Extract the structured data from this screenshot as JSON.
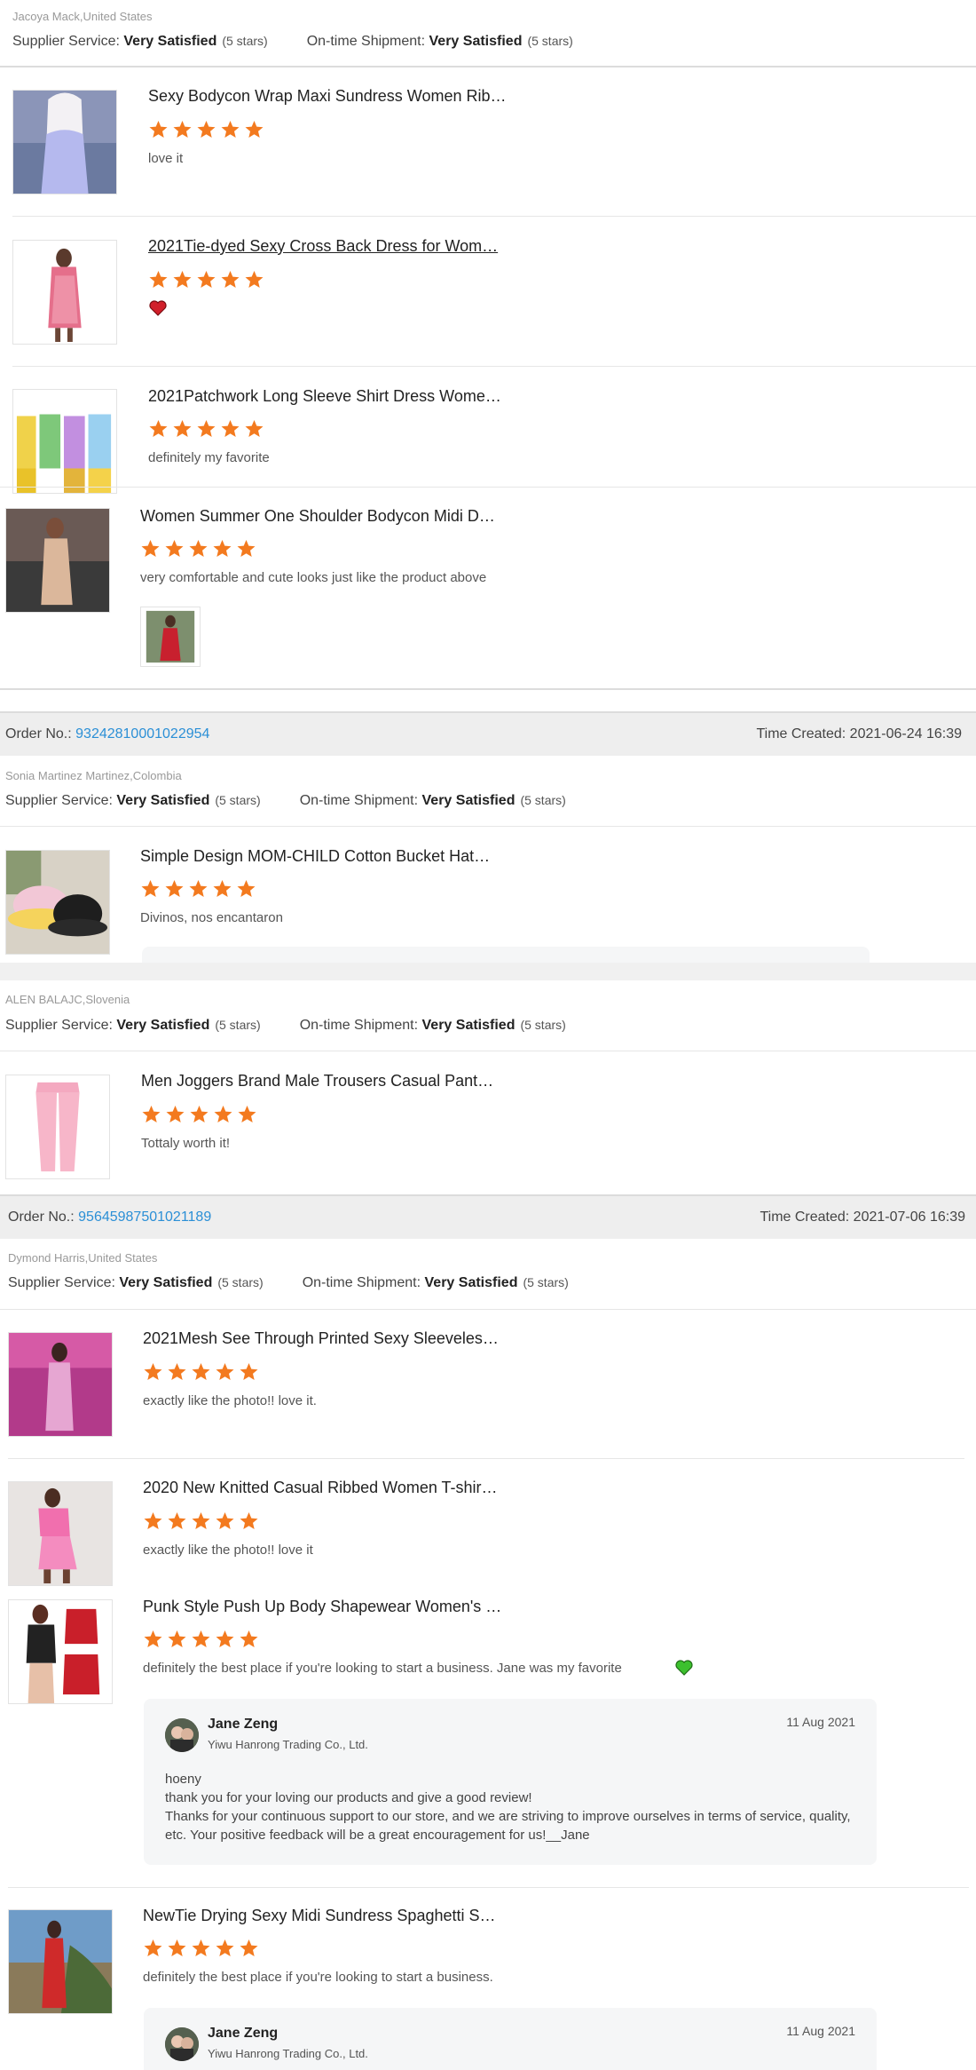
{
  "star_color": "#f37a1f",
  "link_color": "#2b8fd6",
  "order_label": "Order No.: ",
  "time_label": "Time Created: ",
  "supplier_label": "Supplier Service: ",
  "shipment_label": "On-time Shipment: ",
  "ratings_value": "Very Satisfied",
  "ratings_stars": "(5 stars)",
  "feedbacks": [
    {
      "buyer": "Jacoya Mack,United States",
      "items": [
        {
          "title": "Sexy Bodycon Wrap Maxi Sundress Women Rib…",
          "rating": 5,
          "review": "love it"
        },
        {
          "title": "2021Tie-dyed Sexy Cross Back Dress for Wom…",
          "rating": 5,
          "review": "",
          "emoji": "red-heart-icon"
        },
        {
          "title": "2021Patchwork Long Sleeve Shirt Dress Wome…",
          "rating": 5,
          "review": "definitely my favorite"
        },
        {
          "title": "Women Summer One Shoulder Bodycon Midi D…",
          "rating": 5,
          "review": "very comfortable and cute looks just like the product above"
        }
      ]
    },
    {
      "order_no": "93242810001022954",
      "time_created": "2021-06-24 16:39",
      "buyer": "Sonia Martinez Martinez,Colombia",
      "items": [
        {
          "title": "Simple Design MOM-CHILD Cotton Bucket Hat…",
          "rating": 5,
          "review": "Divinos, nos encantaron"
        }
      ]
    },
    {
      "buyer": "ALEN BALAJC,Slovenia",
      "items": [
        {
          "title": "Men Joggers Brand Male Trousers Casual Pant…",
          "rating": 5,
          "review": "Tottaly worth it!"
        }
      ]
    },
    {
      "order_no": "95645987501021189",
      "time_created": "2021-07-06 16:39",
      "buyer": "Dymond Harris,United States",
      "items": [
        {
          "title": "2021Mesh See Through Printed Sexy Sleeveles…",
          "rating": 5,
          "review": "exactly like the photo!! love it."
        },
        {
          "title": "2020 New Knitted Casual Ribbed Women T-shir…",
          "rating": 5,
          "review": "exactly like the photo!! love it"
        },
        {
          "title": "Punk Style Push Up Body Shapewear Women's …",
          "rating": 5,
          "review": "definitely the best place if you're looking to start a business. Jane was my favorite",
          "emoji": "green-heart-icon",
          "reply": {
            "name": "Jane Zeng",
            "company": "Yiwu Hanrong Trading Co., Ltd.",
            "date": "11 Aug 2021",
            "text": "hoeny\nthank you for your loving our products and give a good review!\nThanks for your continuous support to our store, and we are striving to improve ourselves in terms of service, quality, etc. Your positive feedback will be a great encouragement for us!__Jane"
          }
        },
        {
          "title": "NewTie Drying Sexy Midi Sundress Spaghetti S…",
          "rating": 5,
          "review": "definitely the best place if you're looking to start a business.",
          "reply": {
            "name": "Jane Zeng",
            "company": "Yiwu Hanrong Trading Co., Ltd.",
            "date": "11 Aug 2021"
          }
        }
      ]
    }
  ]
}
